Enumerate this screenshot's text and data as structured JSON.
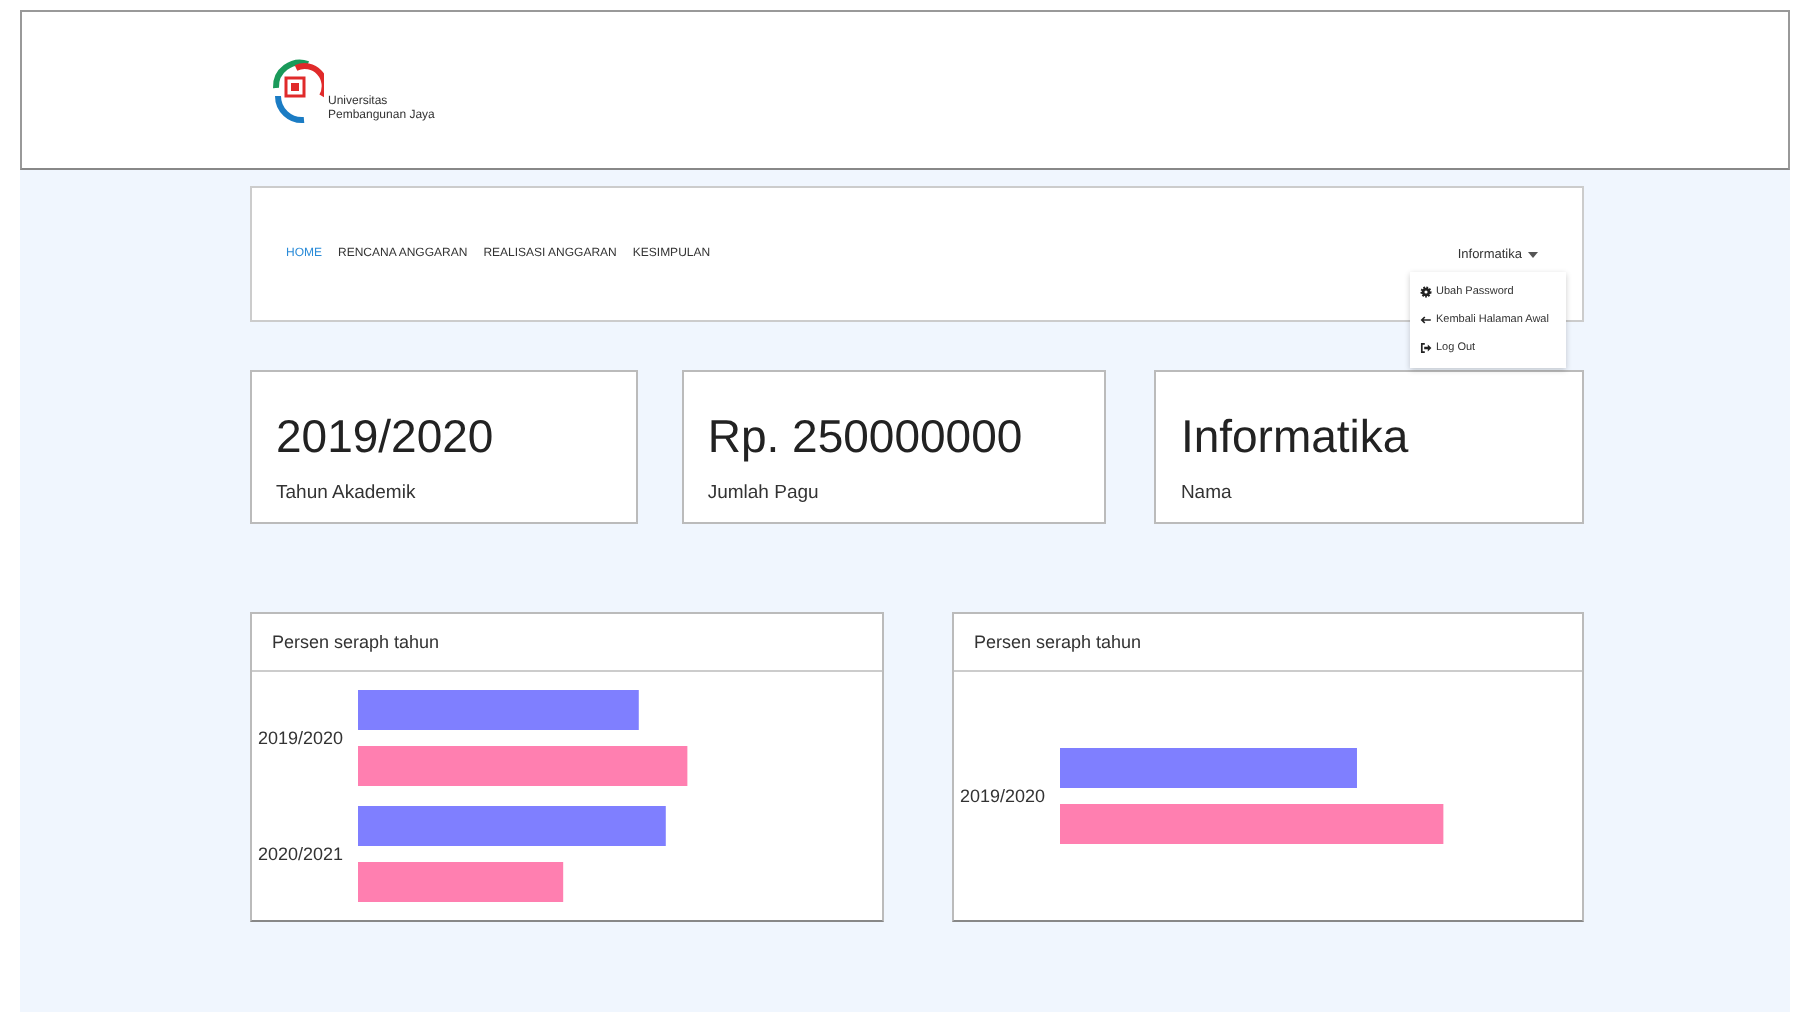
{
  "header": {
    "logo": {
      "line1": "Universitas",
      "line2": "Pembangunan Jaya"
    }
  },
  "nav": {
    "items": [
      {
        "label": "HOME",
        "selected": true
      },
      {
        "label": "RENCANA ANGGARAN",
        "selected": false
      },
      {
        "label": "REALISASI ANGGARAN",
        "selected": false
      },
      {
        "label": "KESIMPULAN",
        "selected": false
      }
    ],
    "user_menu": {
      "label": "Informatika",
      "expanded": true,
      "items": [
        {
          "label": "Ubah Password",
          "kind": "gear"
        },
        {
          "label": "Kembali Halaman Awal",
          "kind": "back"
        },
        {
          "label": "Log Out",
          "kind": "logout"
        }
      ]
    }
  },
  "stats": [
    {
      "value": "2019/2020",
      "label": "Tahun Akademik"
    },
    {
      "value": "Rp. 250000000",
      "label": "Jumlah Pagu"
    },
    {
      "value": "Informatika",
      "label": "Nama"
    }
  ],
  "charts": [
    {
      "title": "Persen seraph tahun",
      "categories": [
        "2019/2020",
        "2020/2021"
      ]
    },
    {
      "title": "Persen seraph tahun",
      "categories": [
        "2019/2020"
      ]
    }
  ]
}
